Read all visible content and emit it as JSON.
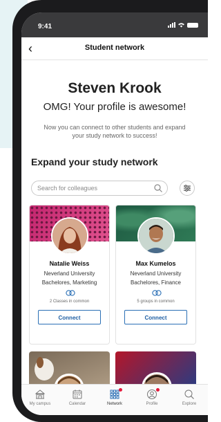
{
  "status_bar": {
    "time": "9:41"
  },
  "nav": {
    "title": "Student network"
  },
  "profile": {
    "name": "Steven Krook",
    "tagline": "OMG! Your profile is awesome!",
    "description": "Now you can connect to other students and expand your study network to success!"
  },
  "network": {
    "section_title": "Expand your study network",
    "search_placeholder": "Search for colleagues"
  },
  "cards": [
    {
      "name": "Natalie Weiss",
      "university": "Neverland University",
      "program": "Bachelores, Marketing",
      "common": "2 Classes in common",
      "connect_label": "Connect"
    },
    {
      "name": "Max Kumelos",
      "university": "Neverland University",
      "program": "Bachelores, Finance",
      "common": "5 groups in common",
      "connect_label": "Connect"
    }
  ],
  "tabs": [
    {
      "label": "My campus",
      "icon": "campus-icon"
    },
    {
      "label": "Calendar",
      "icon": "calendar-icon"
    },
    {
      "label": "Network",
      "icon": "network-icon",
      "active": true,
      "notification": true
    },
    {
      "label": "Profile",
      "icon": "profile-icon",
      "notification": true
    },
    {
      "label": "Explore",
      "icon": "search-icon"
    }
  ],
  "colors": {
    "accent": "#1f5fa3",
    "notification": "#e4173a",
    "banner_pink": "#c4266f",
    "banner_green": "#1e5a42"
  }
}
